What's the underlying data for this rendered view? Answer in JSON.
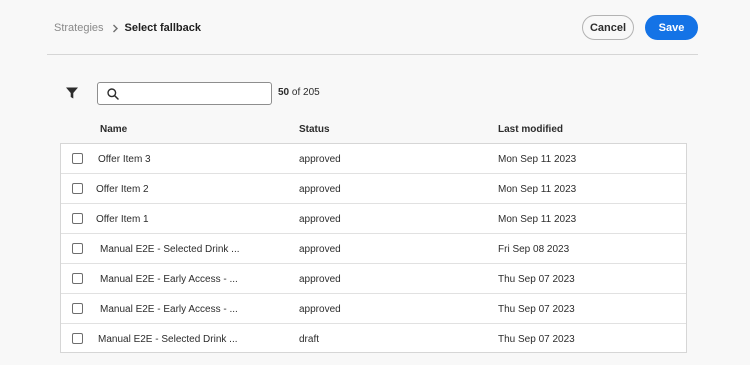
{
  "breadcrumb": {
    "parent": "Strategies",
    "current": "Select fallback"
  },
  "actions": {
    "cancel_label": "Cancel",
    "save_label": "Save"
  },
  "search": {
    "value": "",
    "placeholder": ""
  },
  "count": {
    "shown": "50",
    "of_label": "of",
    "total": "205"
  },
  "table": {
    "columns": {
      "name": "Name",
      "status": "Status",
      "last_modified": "Last modified"
    },
    "rows": [
      {
        "name": "Offer Item 3",
        "status": "approved",
        "last_modified": "Mon Sep 11 2023"
      },
      {
        "name": "Offer Item 2",
        "status": "approved",
        "last_modified": "Mon Sep 11 2023"
      },
      {
        "name": "Offer Item 1",
        "status": "approved",
        "last_modified": "Mon Sep 11 2023"
      },
      {
        "name": "Manual E2E - Selected Drink ...",
        "status": "approved",
        "last_modified": "Fri Sep 08 2023"
      },
      {
        "name": "Manual E2E - Early Access - ...",
        "status": "approved",
        "last_modified": "Thu Sep 07 2023"
      },
      {
        "name": "Manual E2E - Early Access - ...",
        "status": "approved",
        "last_modified": "Thu Sep 07 2023"
      },
      {
        "name": "Manual E2E - Selected Drink ...",
        "status": "draft",
        "last_modified": "Thu Sep 07 2023"
      }
    ]
  },
  "colors": {
    "accent": "#1473e6",
    "text": "#2c2c2c",
    "muted": "#8a8a8a"
  },
  "icons": {
    "filter": "filter-icon",
    "search": "search-icon",
    "separator": "chevron-right-icon"
  }
}
